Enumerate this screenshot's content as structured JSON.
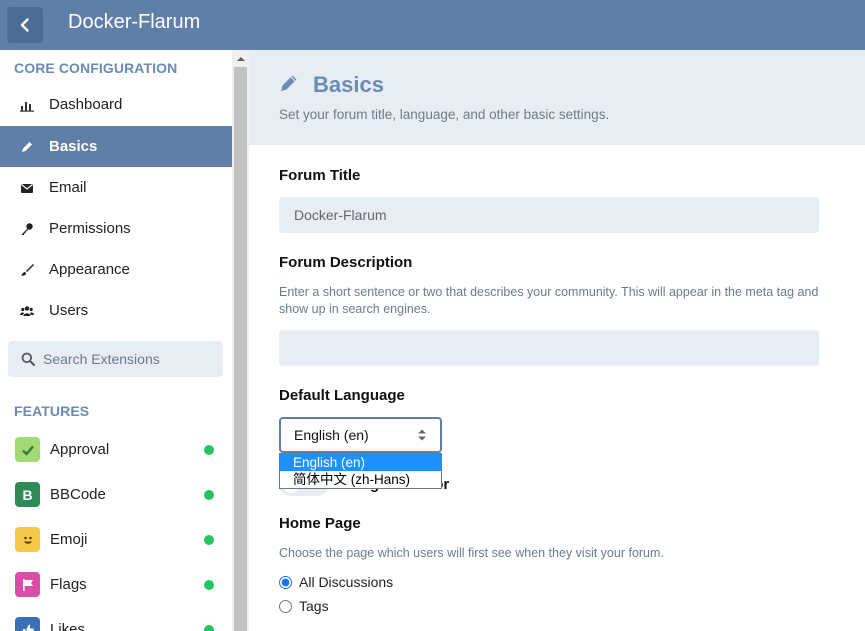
{
  "header": {
    "title": "Docker-Flarum"
  },
  "sidebar": {
    "core_title": "CORE CONFIGURATION",
    "items": [
      {
        "label": "Dashboard",
        "icon": "chart-icon"
      },
      {
        "label": "Basics",
        "icon": "pencil-icon",
        "active": true
      },
      {
        "label": "Email",
        "icon": "envelope-icon"
      },
      {
        "label": "Permissions",
        "icon": "key-icon"
      },
      {
        "label": "Appearance",
        "icon": "paintbrush-icon"
      },
      {
        "label": "Users",
        "icon": "users-icon"
      }
    ],
    "search_placeholder": "Search Extensions",
    "features_title": "FEATURES",
    "extensions": [
      {
        "label": "Approval",
        "icon": "check-icon",
        "color": "#a3d977",
        "enabled": true
      },
      {
        "label": "BBCode",
        "icon": "bold-b-icon",
        "color": "#2e8b57",
        "enabled": true
      },
      {
        "label": "Emoji",
        "icon": "smiley-icon",
        "color": "#f7c948",
        "enabled": true
      },
      {
        "label": "Flags",
        "icon": "flag-icon",
        "color": "#d94fa8",
        "enabled": true
      },
      {
        "label": "Likes",
        "icon": "thumbs-up-icon",
        "color": "#3b6fb6",
        "enabled": true
      }
    ],
    "status_color": "#22c55e"
  },
  "main": {
    "title": "Basics",
    "description": "Set your forum title, language, and other basic settings.",
    "forum_title_label": "Forum Title",
    "forum_title_value": "Docker-Flarum",
    "forum_description_label": "Forum Description",
    "forum_description_help": "Enter a short sentence or two that describes your community. This will appear in the meta tag and show up in search engines.",
    "forum_description_value": "",
    "default_language_label": "Default Language",
    "default_language_value": "English (en)",
    "language_options": [
      "English (en)",
      "简体中文 (zh-Hans)"
    ],
    "switch_label": "ge selector",
    "home_page_label": "Home Page",
    "home_page_help": "Choose the page which users will first see when they visit your forum.",
    "home_page_options": [
      {
        "label": "All Discussions",
        "checked": true
      },
      {
        "label": "Tags",
        "checked": false
      }
    ]
  },
  "colors": {
    "accent": "#5f7fa7",
    "muted_bg": "#e7edf3",
    "heading": "#6b8bb2"
  }
}
